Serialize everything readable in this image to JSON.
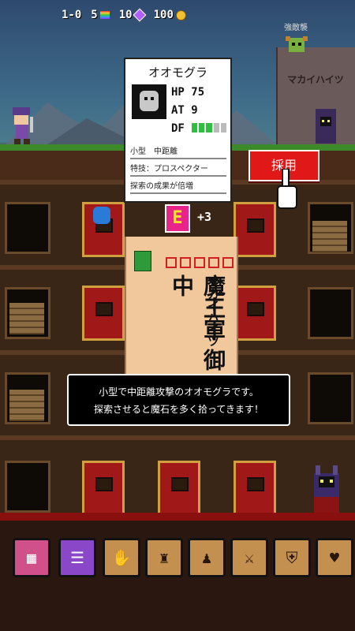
{
  "hud": {
    "floor": "1-0",
    "rainbow_count": "5",
    "gems": "10",
    "coins": "100"
  },
  "top_tag": "強敵襲",
  "castle_sign": "マカイハイツ",
  "card": {
    "name": "オオモグラ",
    "hp_label": "HP",
    "hp_value": "75",
    "at_label": "AT",
    "at_value": "9",
    "df_label": "DF",
    "df_level": 0.6,
    "type": "小型　中距離",
    "skill": "特技：プロスペクター",
    "effect": "探索の成果が倍増"
  },
  "hire_button_label": "採用",
  "rank": {
    "letter": "E",
    "bonus": "+3"
  },
  "envelope": {
    "recipient_line1": "マカイハイツ",
    "recipient_line2": "魔王軍 御中"
  },
  "dialog": {
    "line1": "小型で中距離攻撃のオオモグラです。",
    "line2": "探索させると魔石を多く拾ってきます！"
  },
  "toolbar": {
    "buttons": [
      "building",
      "list",
      "hands",
      "helmet",
      "scarecrow",
      "sword",
      "shield",
      "heart-hands"
    ]
  },
  "colors": {
    "hire_button": "#e01818",
    "rank_bg": "#e8248a",
    "rank_letter": "#f6e030",
    "df_bar": "#2fbf3f",
    "envelope": "#f0c89c",
    "red_door": "#a01818"
  }
}
